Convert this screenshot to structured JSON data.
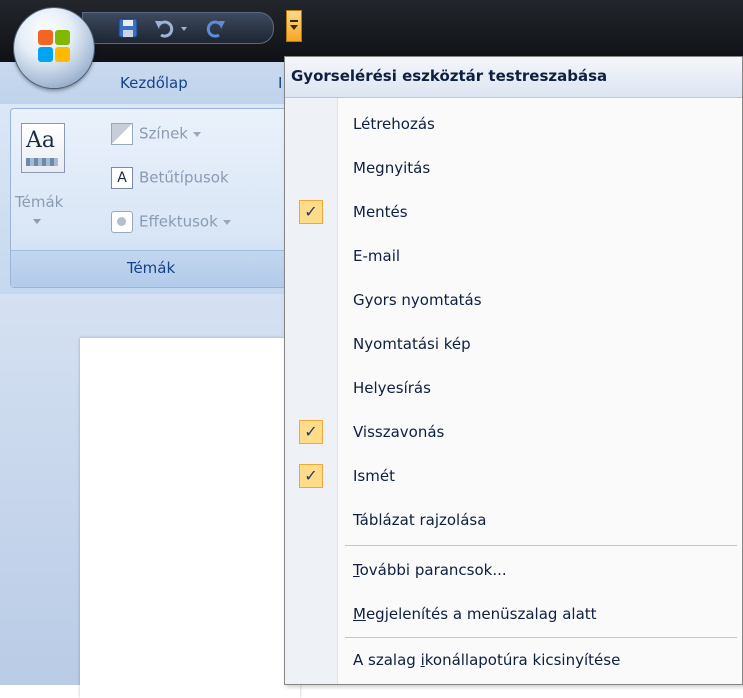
{
  "ribbon": {
    "home_tab": "Kezdőlap",
    "group": {
      "title": "Témák",
      "big_button_label": "Témák",
      "items": [
        {
          "label": "Színek",
          "icon": "colors-icon"
        },
        {
          "label": "Betűtípusok",
          "icon": "fonts-icon",
          "glyph": "A"
        },
        {
          "label": "Effektusok",
          "icon": "effects-icon"
        }
      ]
    }
  },
  "menu": {
    "header": "Gyorselérési eszköztár testreszabása",
    "items": [
      {
        "label": "Létrehozás",
        "checked": false
      },
      {
        "label": "Megnyitás",
        "checked": false
      },
      {
        "label": "Mentés",
        "checked": true
      },
      {
        "label": "E-mail",
        "checked": false
      },
      {
        "label": "Gyors nyomtatás",
        "checked": false
      },
      {
        "label": "Nyomtatási kép",
        "checked": false
      },
      {
        "label": "Helyesírás",
        "checked": false
      },
      {
        "label": "Visszavonás",
        "checked": true
      },
      {
        "label": "Ismét",
        "checked": true
      },
      {
        "label": "Táblázat rajzolása",
        "checked": false
      }
    ],
    "more_commands": {
      "pre": "",
      "accel": "T",
      "post": "ovábbi parancsok..."
    },
    "show_below": {
      "pre": "",
      "accel": "M",
      "post": "egjelenítés a menüszalag alatt"
    },
    "minimize": {
      "pre": "A szalag ",
      "accel": "i",
      "post": "konállapotúra kicsinyítése"
    },
    "check_glyph": "✓"
  },
  "colors": {
    "check_bg": "#fedc8a",
    "accent": "#15428b"
  }
}
